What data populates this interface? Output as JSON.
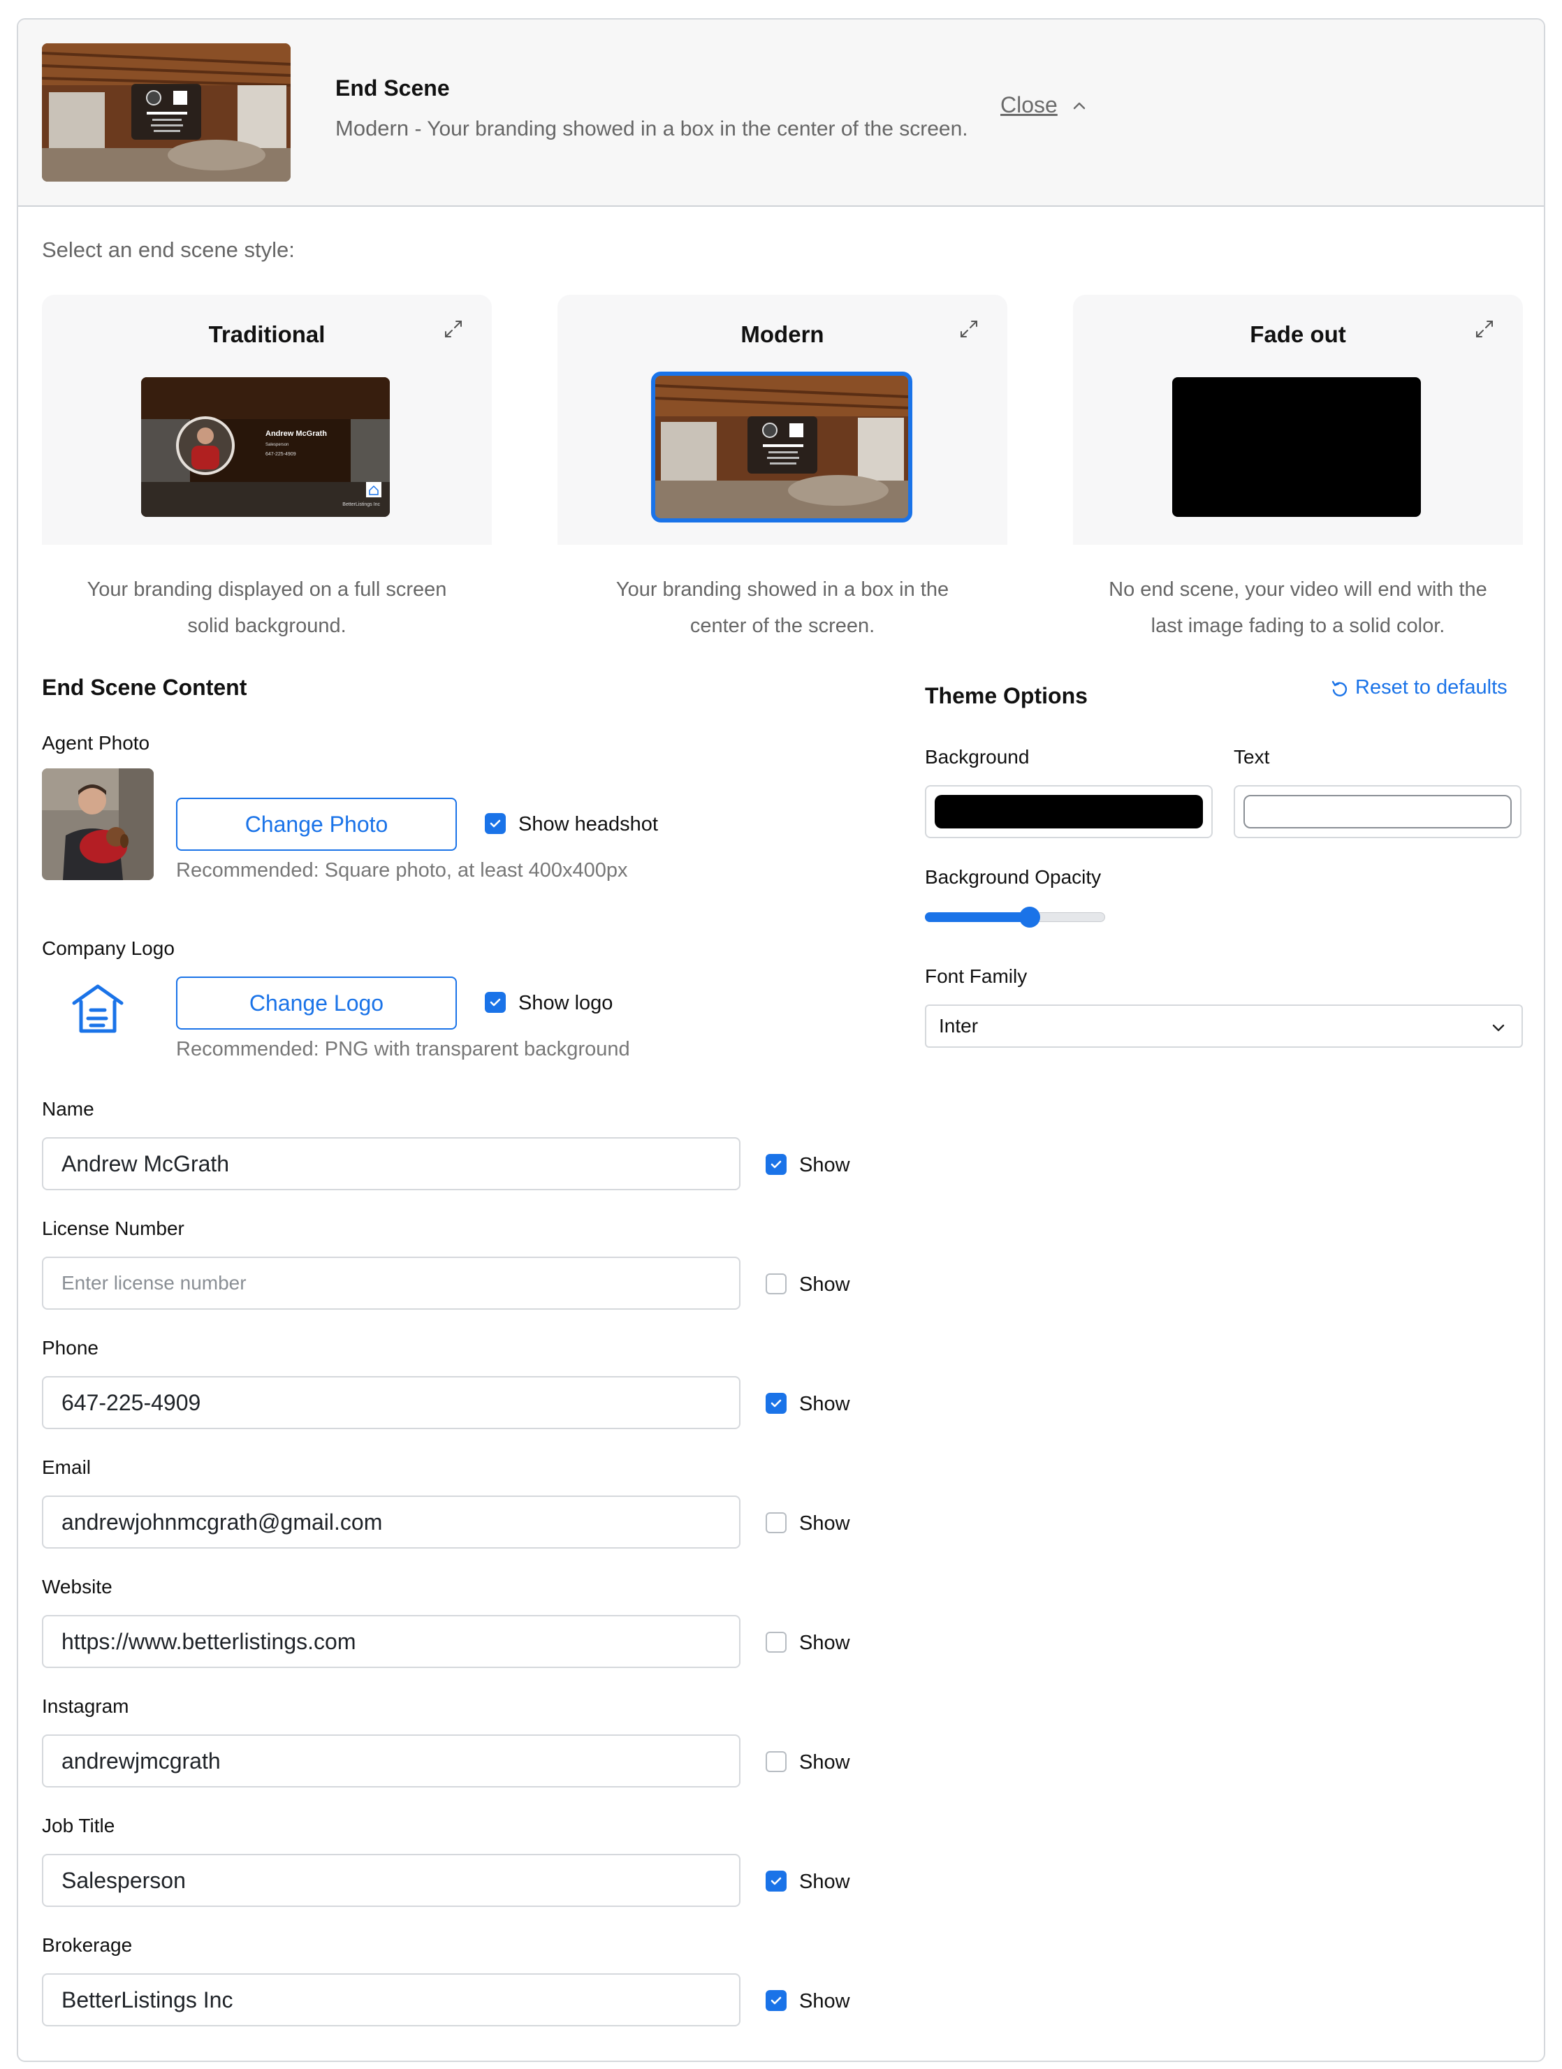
{
  "header": {
    "title": "End Scene",
    "style_name": "Modern",
    "separator": " - ",
    "description": "Your branding showed in a box in the center of the screen.",
    "close_label": "Close"
  },
  "style_select": {
    "label": "Select an end scene style:",
    "selected": "Modern",
    "options": [
      {
        "title": "Traditional",
        "desc_line1": "Your branding displayed on a full screen",
        "desc_line2": "solid background.",
        "preview": {
          "name": "Andrew McGrath",
          "title": "Salesperson",
          "phone": "647-225-4909",
          "brokerage": "BetterListings Inc"
        }
      },
      {
        "title": "Modern",
        "desc_line1": "Your branding showed in a box in the",
        "desc_line2": "center of the screen."
      },
      {
        "title": "Fade out",
        "desc_line1": "No end scene, your video will end with the",
        "desc_line2": "last image fading to a solid color."
      }
    ]
  },
  "content": {
    "title": "End Scene Content",
    "agent_photo": {
      "label": "Agent Photo",
      "button": "Change Photo",
      "show_label": "Show headshot",
      "show": true,
      "hint": "Recommended: Square photo, at least 400x400px"
    },
    "company_logo": {
      "label": "Company Logo",
      "button": "Change Logo",
      "show_label": "Show logo",
      "show": true,
      "hint": "Recommended: PNG with transparent background"
    },
    "fields": [
      {
        "label": "Name",
        "value": "Andrew McGrath",
        "placeholder": "",
        "show": true,
        "show_label": "Show"
      },
      {
        "label": "License Number",
        "value": "",
        "placeholder": "Enter license number",
        "show": false,
        "show_label": "Show"
      },
      {
        "label": "Phone",
        "value": "647-225-4909",
        "placeholder": "",
        "show": true,
        "show_label": "Show"
      },
      {
        "label": "Email",
        "value": "andrewjohnmcgrath@gmail.com",
        "placeholder": "",
        "show": false,
        "show_label": "Show"
      },
      {
        "label": "Website",
        "value": "https://www.betterlistings.com",
        "placeholder": "",
        "show": false,
        "show_label": "Show"
      },
      {
        "label": "Instagram",
        "value": "andrewjmcgrath",
        "placeholder": "",
        "show": false,
        "show_label": "Show"
      },
      {
        "label": "Job Title",
        "value": "Salesperson",
        "placeholder": "",
        "show": true,
        "show_label": "Show"
      },
      {
        "label": "Brokerage",
        "value": "BetterListings Inc",
        "placeholder": "",
        "show": true,
        "show_label": "Show"
      }
    ]
  },
  "theme": {
    "title": "Theme Options",
    "reset_label": "Reset to defaults",
    "background_label": "Background",
    "background_color": "#000000",
    "text_label": "Text",
    "text_color": "#ffffff",
    "opacity_label": "Background Opacity",
    "opacity": 0.58,
    "font_label": "Font Family",
    "font_value": "Inter"
  },
  "colors": {
    "accent": "#1a73e8",
    "border": "#d5d8dc",
    "muted_text": "#666666"
  }
}
